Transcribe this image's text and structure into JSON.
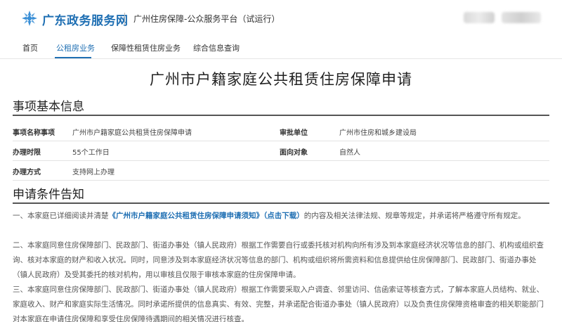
{
  "header": {
    "brand": "广东政务服务网",
    "platform": "广州住房保障-公众服务平台（试运行）"
  },
  "nav": {
    "items": [
      {
        "label": "首页"
      },
      {
        "label": "公租房业务"
      },
      {
        "label": "保障性租赁住房业务"
      },
      {
        "label": "综合信息查询"
      }
    ],
    "active_index": 1
  },
  "page": {
    "title": "广州市户籍家庭公共租赁住房保障申请"
  },
  "basic_info": {
    "heading": "事项基本信息",
    "rows": [
      {
        "label1": "事项名称事项",
        "value1": "广州市户籍家庭公共租赁住房保障申请",
        "label2": "审批单位",
        "value2": "广州市住房和城乡建设局"
      },
      {
        "label1": "办理时限",
        "value1": "55个工作日",
        "label2": "面向对象",
        "value2": "自然人"
      },
      {
        "label1": "办理方式",
        "value1": "支持网上办理",
        "label2": "",
        "value2": ""
      }
    ]
  },
  "conditions": {
    "heading": "申请条件告知",
    "p1_before": "一、本家庭已详细阅读并清楚",
    "p1_link": "《广州市户籍家庭公共租赁住房保障申请须知》（点击下载）",
    "p1_after": "的内容及相关法律法规、规章等规定，并承诺将严格遵守所有规定。",
    "p2": "二、本家庭同意住房保障部门、民政部门、街道办事处（镇人民政府）根据工作需要自行或委托核对机构向所有涉及到本家庭经济状况等信息的部门、机构或组织查询、核对本家庭的财产和收入状况。同时，同意涉及到本家庭经济状况等信息的部门、机构或组织将所需资料和信息提供给住房保障部门、民政部门、街道办事处（镇人民政府）及受其委托的核对机构，用以审核且仅限于审核本家庭的住房保障申请。",
    "p3": "三、本家庭同意住房保障部门、民政部门、街道办事处（镇人民政府）根据工作需要采取入户调查、邻里访问、信函索证等核查方式，了解本家庭人员结构、就业、家庭收入、财产和家庭实际生活情况。同时承诺所提供的信息真实、有效、完整，并承诺配合街道办事处（镇人民政府）以及负责住房保障资格审查的相关职能部门对本家庭在申请住房保障和享受住房保障待遇期间的相关情况进行核查。"
  },
  "colors": {
    "accent": "#1f6fb3",
    "logo": "#3a8fd6"
  }
}
